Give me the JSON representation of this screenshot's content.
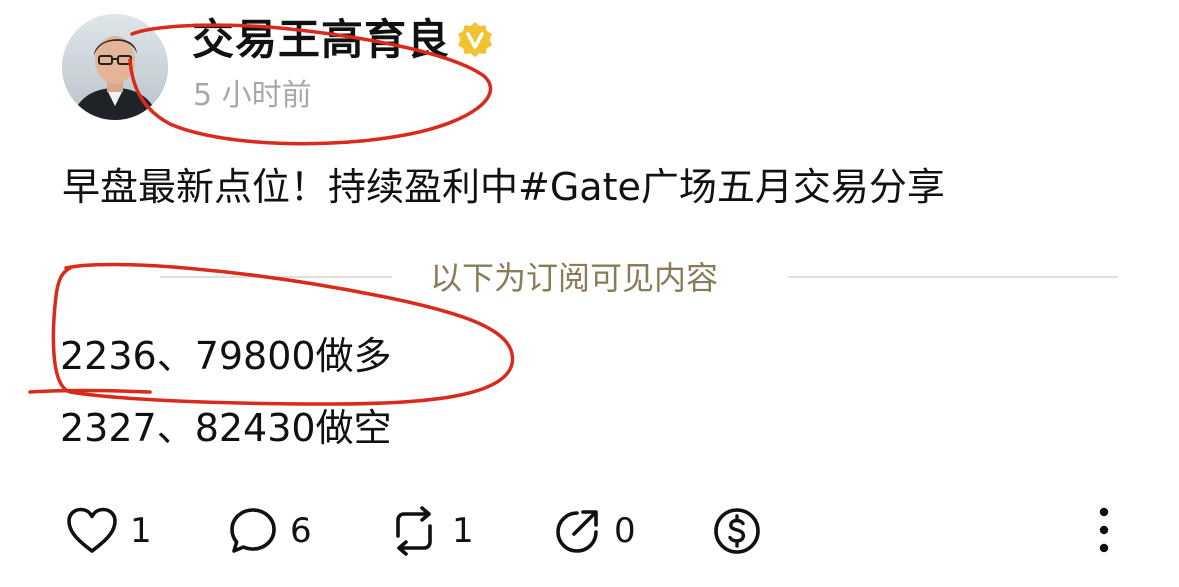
{
  "post": {
    "author": "交易王高育良",
    "time": "5 小时前",
    "title": "早盘最新点位！持续盈利中#Gate广场五月交易分享",
    "subscriber_divider": "以下为订阅可见内容",
    "signals": [
      "2236、79800做多",
      "2327、82430做空"
    ]
  },
  "actions": {
    "like_count": "1",
    "comment_count": "6",
    "repost_count": "1",
    "share_count": "0"
  },
  "icons": {
    "verified": "verified-badge-icon",
    "like": "heart-icon",
    "comment": "comment-bubble-icon",
    "repost": "repost-icon",
    "share": "share-icon",
    "tip": "dollar-coin-icon",
    "more": "more-vertical-icon"
  },
  "colors": {
    "verified_badge": "#f2c230",
    "subscriber_label": "#8a7b59",
    "annotation_red": "#d92a1c",
    "muted_text": "#a8a8a8"
  }
}
